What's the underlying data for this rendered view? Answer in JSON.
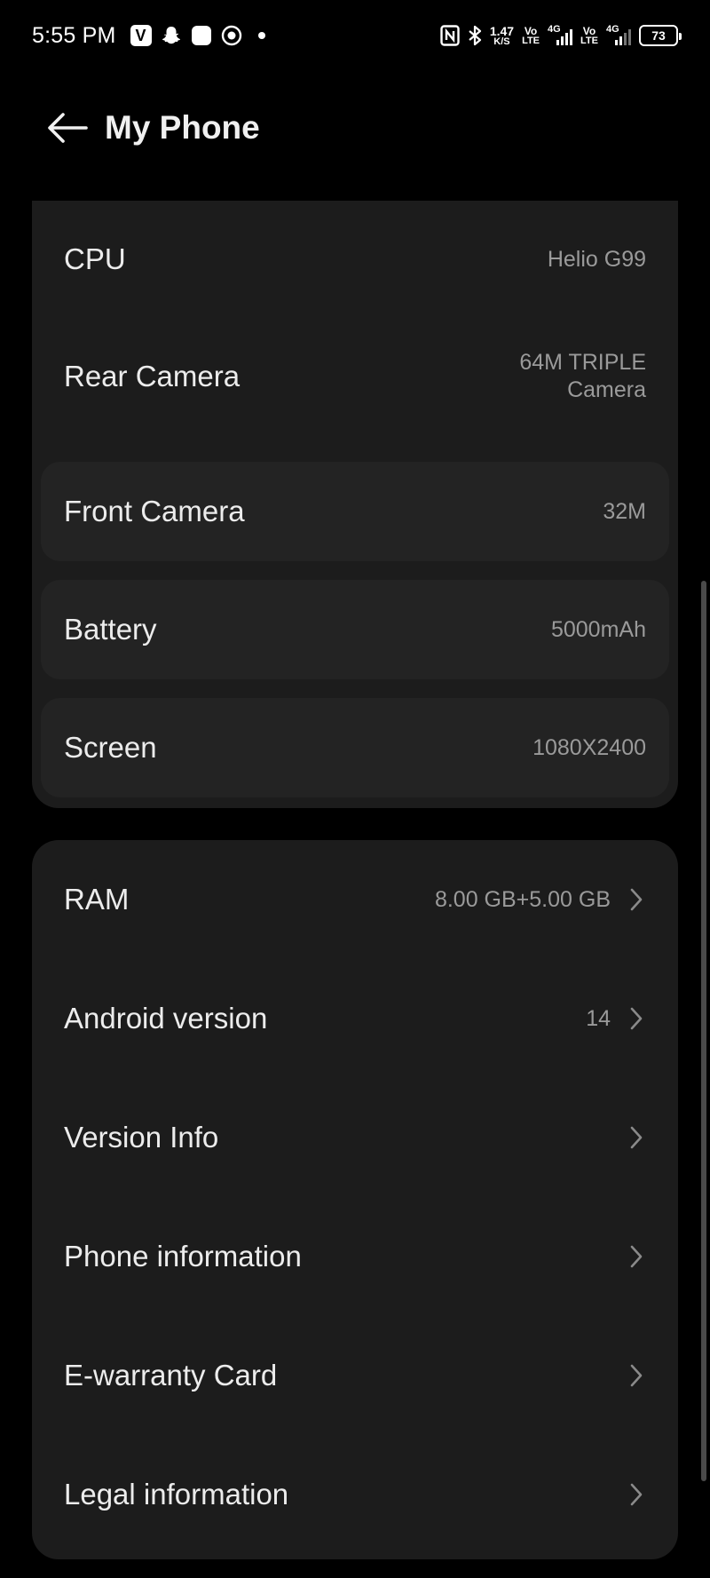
{
  "status_bar": {
    "time": "5:55 PM",
    "net_speed_value": "1.47",
    "net_speed_unit": "K/S",
    "sim1_volte_top": "Vo",
    "sim1_volte_bottom": "LTE",
    "sim1_network": "4G",
    "sim2_volte_top": "Vo",
    "sim2_volte_bottom": "LTE",
    "sim2_network": "4G",
    "battery_level": "73"
  },
  "header": {
    "title": "My Phone"
  },
  "specs": [
    {
      "label": "CPU",
      "value": "Helio G99"
    },
    {
      "label": "Rear Camera",
      "value_line1": "64M TRIPLE",
      "value_line2": "Camera"
    },
    {
      "label": "Front Camera",
      "value": "32M"
    },
    {
      "label": "Battery",
      "value": "5000mAh"
    },
    {
      "label": "Screen",
      "value": "1080X2400"
    }
  ],
  "menu": [
    {
      "label": "RAM",
      "value": "8.00 GB+5.00 GB"
    },
    {
      "label": "Android version",
      "value": "14"
    },
    {
      "label": "Version Info",
      "value": ""
    },
    {
      "label": "Phone information",
      "value": ""
    },
    {
      "label": "E-warranty Card",
      "value": ""
    },
    {
      "label": "Legal information",
      "value": ""
    }
  ]
}
